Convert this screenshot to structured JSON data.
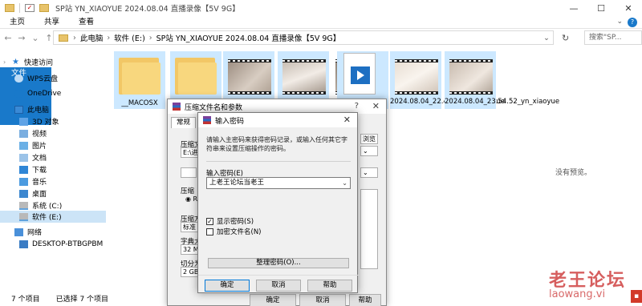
{
  "window": {
    "title": "SP站 YN_XIAOYUE 2024.08.04 直播录像【5V 9G】",
    "controls": [
      "—",
      "☐",
      "✕"
    ]
  },
  "ribbon": {
    "tabs": [
      "文件",
      "主页",
      "共享",
      "查看"
    ],
    "expand": "⌄",
    "help": "?"
  },
  "address": {
    "crumbs": [
      "此电脑",
      "软件 (E:)",
      "SP站 YN_XIAOYUE 2024.08.04 直播录像【5V 9G】"
    ],
    "search_placeholder": "搜索\"SP..."
  },
  "sidebar": {
    "items": [
      {
        "label": "快速访问",
        "icon": "star-icon"
      },
      {
        "label": "WPS云盘",
        "icon": "cloud-icon"
      },
      {
        "label": "OneDrive",
        "icon": "onedrive-icon"
      },
      {
        "label": "此电脑",
        "icon": "computer-icon"
      },
      {
        "label": "3D 对象",
        "icon": "cube-icon"
      },
      {
        "label": "视频",
        "icon": "video-folder-icon"
      },
      {
        "label": "图片",
        "icon": "pictures-icon"
      },
      {
        "label": "文档",
        "icon": "documents-icon"
      },
      {
        "label": "下载",
        "icon": "download-icon"
      },
      {
        "label": "音乐",
        "icon": "music-icon"
      },
      {
        "label": "桌面",
        "icon": "desktop-icon"
      },
      {
        "label": "系统 (C:)",
        "icon": "drive-icon"
      },
      {
        "label": "软件 (E:)",
        "icon": "drive-icon"
      },
      {
        "label": "网络",
        "icon": "network-icon"
      },
      {
        "label": "DESKTOP-BTBGPBM",
        "icon": "computer-icon"
      }
    ]
  },
  "files": [
    {
      "name": "__MACOSX",
      "kind": "folder"
    },
    {
      "name": "",
      "kind": "folder"
    },
    {
      "name": "",
      "kind": "video"
    },
    {
      "name": "",
      "kind": "video"
    },
    {
      "name": "",
      "kind": "video"
    },
    {
      "name": "",
      "kind": "media-file"
    },
    {
      "name": "2024.08.04_22.40.09_yn_xiaoyue",
      "kind": "video"
    },
    {
      "name": "2024.08.04_23.54.52_yn_xiaoyue",
      "kind": "video"
    }
  ],
  "preview": {
    "text": "没有预览。"
  },
  "status": {
    "count": "7 个项目",
    "selected": "已选择 7 个项目"
  },
  "compress_dialog": {
    "title": "压缩文件名和参数",
    "help": "?",
    "close": "✕",
    "tab": "常规",
    "labels": {
      "archive_name": "压缩文",
      "path": "E:\\进",
      "archive_format": "压缩",
      "format_option": "RA",
      "method": "压缩方",
      "method_value": "标准",
      "dict": "字典大",
      "dict_value": "32 MB",
      "split": "切分为",
      "split_value": "2 GB"
    },
    "browse": "浏览(B)...",
    "ok": "确定",
    "cancel": "取消",
    "help_btn": "帮助"
  },
  "password_dialog": {
    "title": "输入密码",
    "close": "✕",
    "description": "请输入主密码来获得密码记录，或输入任何其它字符串来设置压缩操作的密码。",
    "input_label": "输入密码(E)",
    "input_value": "上老王论坛当老王",
    "show_password": "显示密码(S)",
    "show_password_checked": true,
    "encrypt_names": "加密文件名(N)",
    "encrypt_names_checked": false,
    "manage": "整理密码(O)...",
    "ok": "确定",
    "cancel": "取消",
    "help": "帮助"
  },
  "watermark": {
    "text": "老王论坛",
    "url": "laowang.vi"
  }
}
